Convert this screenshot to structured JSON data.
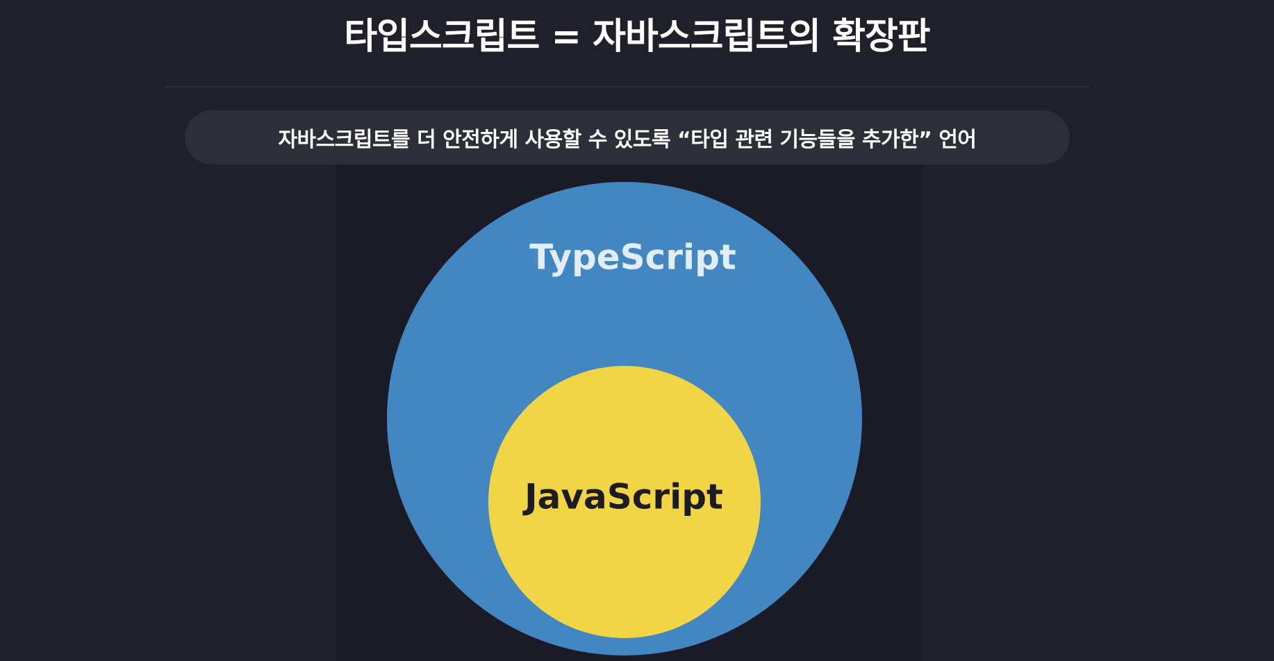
{
  "title": "타입스크립트 = 자바스크립트의 확장판",
  "subtitle": "자바스크립트를 더 안전하게 사용할 수 있도록 “타입 관련 기능들을 추가한” 언어",
  "diagram": {
    "outer_label": "TypeScript",
    "inner_label": "JavaScript",
    "colors": {
      "outer": "#4287c1",
      "inner": "#f2d545",
      "outer_text": "#e3edf7",
      "inner_text": "#1c1c22"
    }
  }
}
